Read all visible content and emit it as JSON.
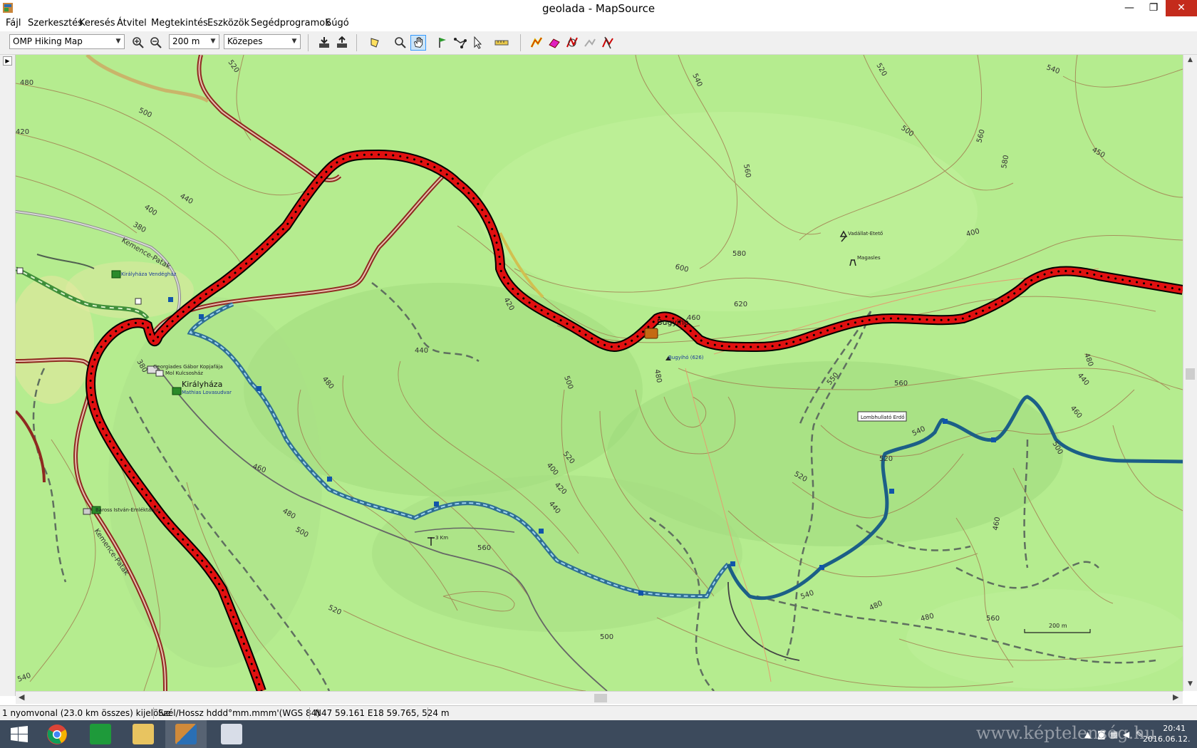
{
  "window": {
    "title": "geolada - MapSource",
    "minimize": "—",
    "maximize": "❐",
    "close": "✕"
  },
  "menu": [
    "Fájl",
    "Szerkesztés",
    "Keresés",
    "Átvitel",
    "Megtekintés",
    "Eszközök",
    "Segédprogramok",
    "Súgó"
  ],
  "toolbar": {
    "map_product": "OMP Hiking Map",
    "zoom_scale": "200 m",
    "detail_level": "Közepes",
    "tools": [
      "zoom-in",
      "zoom-out",
      "receive-from-device",
      "send-to-device",
      "selection",
      "zoom-tool",
      "pan-tool",
      "waypoint-tool",
      "route-tool",
      "selection-arrow",
      "distance-tool",
      "track-tool-1",
      "track-tool-2",
      "track-tool-3",
      "track-tool-4",
      "track-tool-5"
    ],
    "active_tool": "pan-tool"
  },
  "map": {
    "colors": {
      "terrain": "#b5ec8f",
      "track": "#e01010",
      "track_outline": "#000000",
      "trail_red": "#b03a2e",
      "trail_blue": "#3b87b0",
      "trail_green": "#3f8f3a",
      "route_blue": "#1c5f87",
      "contour": "#a0724a",
      "dashed_path": "#5f6f5f"
    },
    "contour_labels": [
      "480",
      "500",
      "420",
      "440",
      "400",
      "380",
      "520",
      "540",
      "560",
      "580",
      "600",
      "620",
      "460",
      "480",
      "520",
      "500",
      "540",
      "560",
      "580",
      "450",
      "400",
      "420",
      "440",
      "480",
      "500",
      "520",
      "400",
      "420",
      "440",
      "460",
      "480",
      "500",
      "520",
      "540",
      "560",
      "500",
      "540",
      "520",
      "540",
      "560",
      "550",
      "520",
      "500",
      "460",
      "440",
      "460",
      "480",
      "480",
      "560",
      "380",
      "480"
    ],
    "place_labels": {
      "bugyiho": "Bugyihó",
      "bugyiho_peak": "Bugyihó (626)",
      "kiralyhaza": "Királyháza",
      "kiralyhaza_vendeghaz": "Királyháza Vendégház",
      "georgiades": "Georgiades Gábor Kopjafája",
      "kulcsoshaz": "Mol Kulcsosház",
      "mathias": "Mathias Lovasudvar",
      "kemence_patak_1": "Kemence-Patak",
      "kemence_patak_2": "Kemence-Patak",
      "baross": "Baross István-Emléktábla",
      "vadallat_etet": "Vadállat-Etető",
      "magasles": "Magasles",
      "lombhullato": "Lombhullató Erdő",
      "km_marker": "3 Km",
      "scale_label": "200 m"
    }
  },
  "statusbar": {
    "selection": "1 nyomvonal (23.0 km összes) kijelölve",
    "coord_format": "Szél/Hossz hddd°mm.mmm'(WGS 84)",
    "cursor_position": "N47 59.161 E18 59.765, 524 m"
  },
  "taskbar": {
    "apps": [
      "windows-start",
      "chrome",
      "store",
      "file-explorer",
      "mapsource",
      "paint"
    ],
    "watermark": "www.képtelenség.hu",
    "time": "20:41",
    "date": "2016.06.12."
  }
}
